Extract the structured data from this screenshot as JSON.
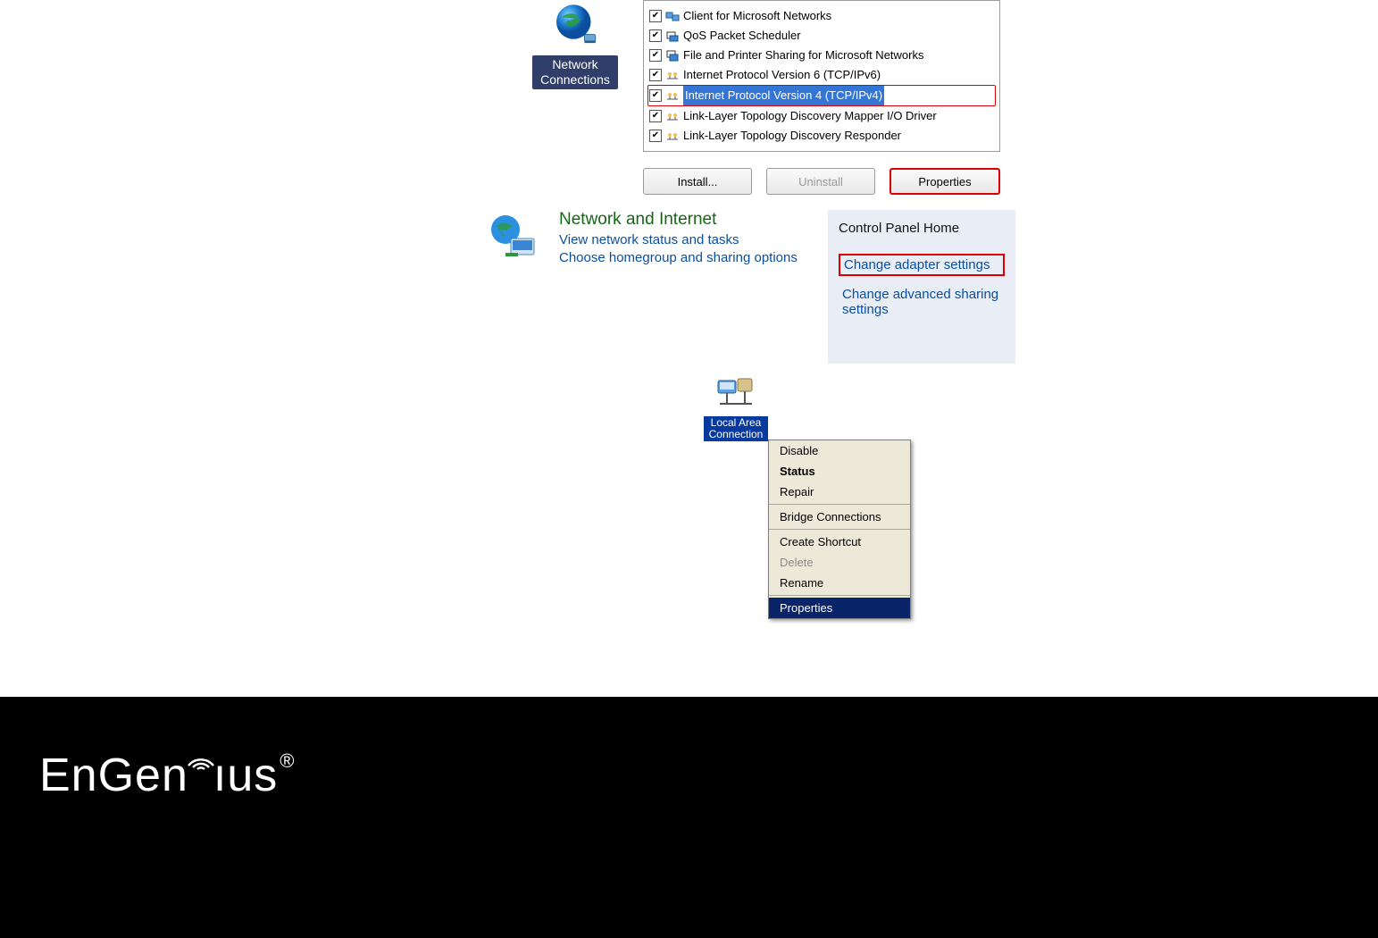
{
  "netconn": {
    "label1": "Network",
    "label2": "Connections"
  },
  "proplist": [
    {
      "label": "Client for Microsoft Networks",
      "icon": "client-icon"
    },
    {
      "label": "QoS Packet Scheduler",
      "icon": "qos-icon"
    },
    {
      "label": "File and Printer Sharing for Microsoft Networks",
      "icon": "share-icon"
    },
    {
      "label": "Internet Protocol Version 6 (TCP/IPv6)",
      "icon": "proto-icon"
    },
    {
      "label": "Internet Protocol Version 4 (TCP/IPv4)",
      "icon": "proto-icon",
      "selected": true
    },
    {
      "label": "Link-Layer Topology Discovery Mapper I/O Driver",
      "icon": "proto-icon"
    },
    {
      "label": "Link-Layer Topology Discovery Responder",
      "icon": "proto-icon"
    }
  ],
  "buttons": {
    "install": "Install...",
    "uninstall": "Uninstall",
    "properties": "Properties"
  },
  "ni": {
    "title": "Network and Internet",
    "link1": "View network status and tasks",
    "link2": "Choose homegroup and sharing options"
  },
  "cp": {
    "header": "Control Panel Home",
    "item1": "Change adapter settings",
    "item2": "Change advanced sharing settings"
  },
  "lac": {
    "label1": "Local Area",
    "label2": "Connection"
  },
  "menu": {
    "disable": "Disable",
    "status": "Status",
    "repair": "Repair",
    "bridge": "Bridge Connections",
    "shortcut": "Create Shortcut",
    "delete": "Delete",
    "rename": "Rename",
    "properties": "Properties"
  },
  "brand": {
    "name": "EnGenius"
  }
}
